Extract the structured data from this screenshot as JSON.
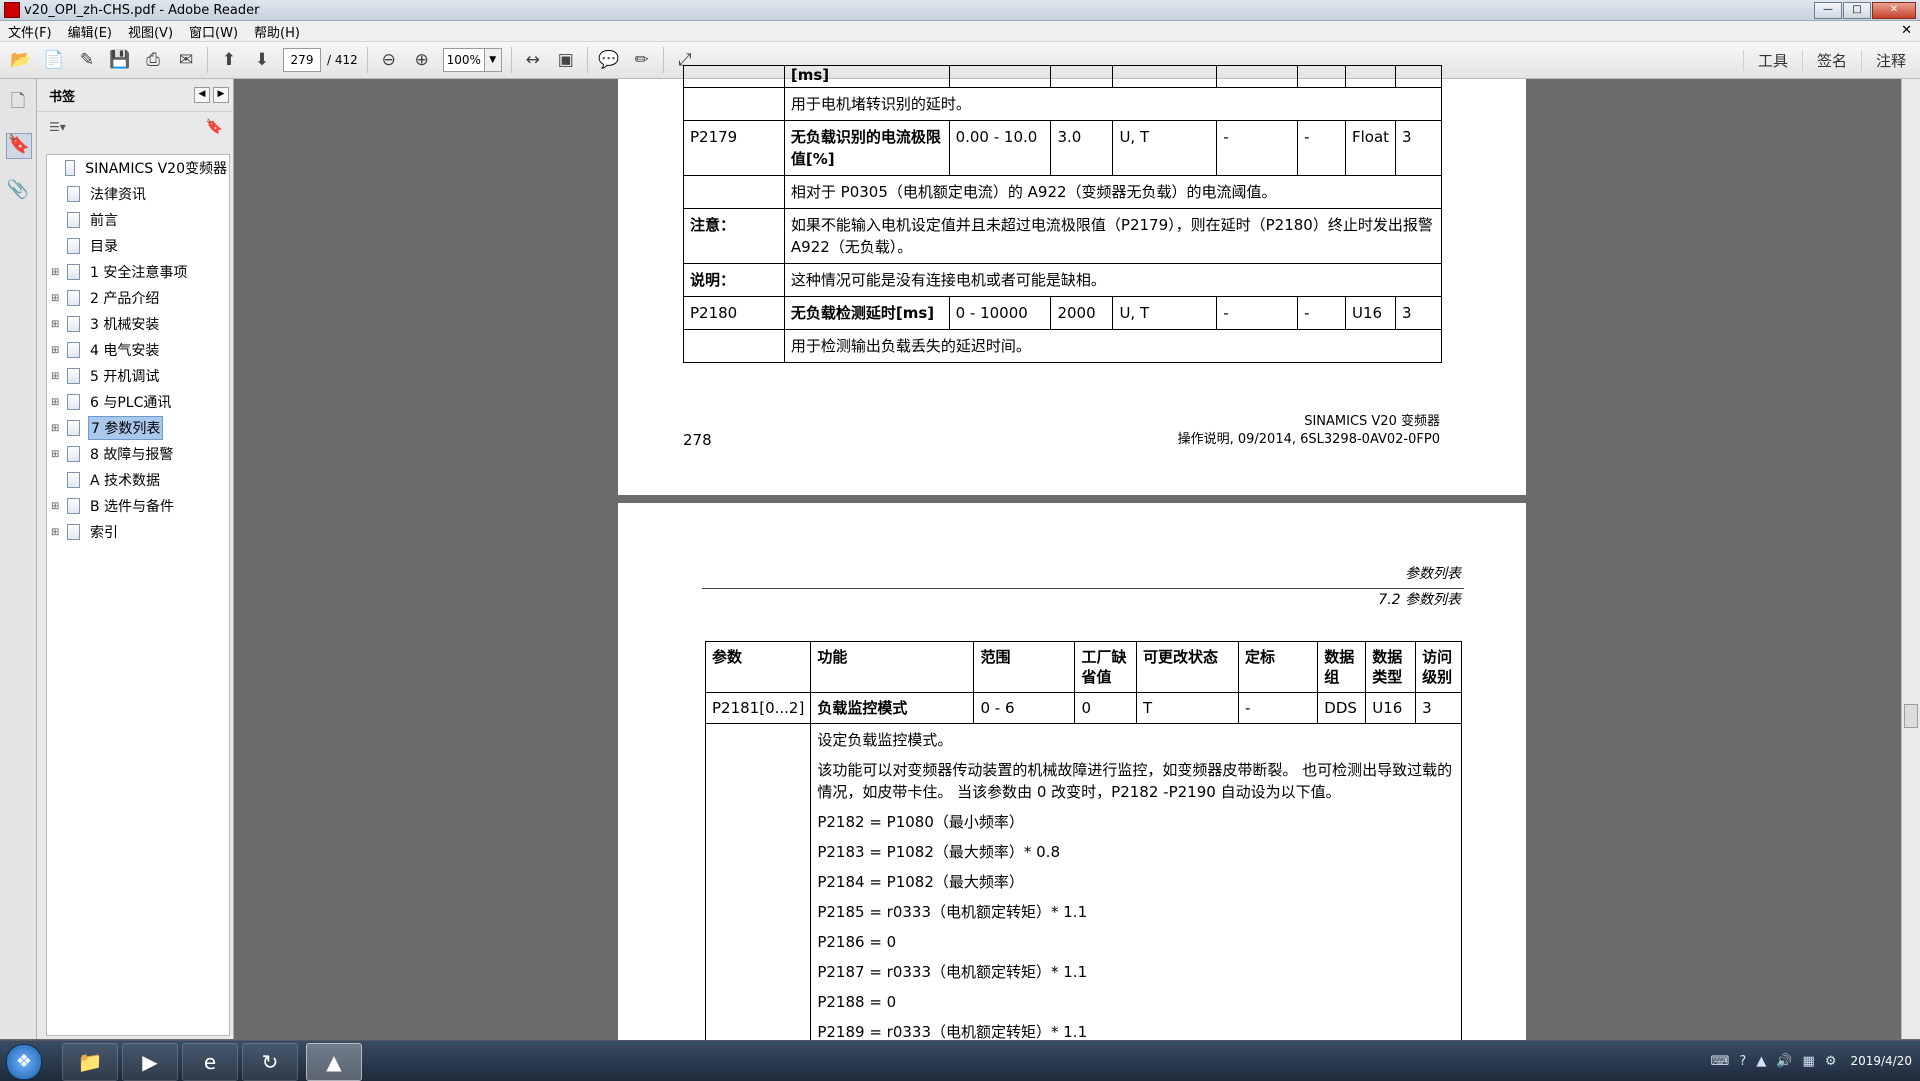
{
  "window": {
    "title": "v20_OPI_zh-CHS.pdf - Adobe Reader"
  },
  "menu": [
    "文件(F)",
    "编辑(E)",
    "视图(V)",
    "窗口(W)",
    "帮助(H)"
  ],
  "toolbar": {
    "page_current": "279",
    "page_total": "/ 412",
    "zoom": "100%",
    "right_links": [
      "工具",
      "签名",
      "注释"
    ]
  },
  "bookmarks": {
    "header": "书签",
    "items": [
      {
        "label": "SINAMICS V20变频器",
        "expandable": false,
        "selected": false
      },
      {
        "label": "法律资讯",
        "expandable": false,
        "selected": false
      },
      {
        "label": "前言",
        "expandable": false,
        "selected": false
      },
      {
        "label": "目录",
        "expandable": false,
        "selected": false
      },
      {
        "label": "1 安全注意事项",
        "expandable": true,
        "selected": false
      },
      {
        "label": "2 产品介绍",
        "expandable": true,
        "selected": false
      },
      {
        "label": "3 机械安装",
        "expandable": true,
        "selected": false
      },
      {
        "label": "4 电气安装",
        "expandable": true,
        "selected": false
      },
      {
        "label": "5 开机调试",
        "expandable": true,
        "selected": false
      },
      {
        "label": "6 与PLC通讯",
        "expandable": true,
        "selected": false
      },
      {
        "label": "7 参数列表",
        "expandable": true,
        "selected": true
      },
      {
        "label": "8 故障与报警",
        "expandable": true,
        "selected": false
      },
      {
        "label": "A 技术数据",
        "expandable": false,
        "selected": false
      },
      {
        "label": "B 选件与备件",
        "expandable": true,
        "selected": false
      },
      {
        "label": "索引",
        "expandable": true,
        "selected": false
      }
    ]
  },
  "page1": {
    "top_fragment": "[ms]",
    "row0_desc": "用于电机堵转识别的延时。",
    "p2179": {
      "param": "P2179",
      "func": "无负载识别的电流极限值[%]",
      "range": "0.00 - 10.0",
      "default": "3.0",
      "change": "U, T",
      "scale": "-",
      "group": "-",
      "type": "Float",
      "access": "3",
      "desc": "相对于 P0305（电机额定电流）的 A922（变频器无负载）的电流阈值。",
      "note_label": "注意：",
      "note": "如果不能输入电机设定值并且未超过电流极限值（P2179），则在延时（P2180）终止时发出报警 A922（无负载）。",
      "explain_label": "说明：",
      "explain": "这种情况可能是没有连接电机或者可能是缺相。"
    },
    "p2180": {
      "param": "P2180",
      "func": "无负载检测延时[ms]",
      "range": "0 - 10000",
      "default": "2000",
      "change": "U, T",
      "scale": "-",
      "group": "-",
      "type": "U16",
      "access": "3",
      "desc": "用于检测输出负载丢失的延迟时间。"
    },
    "page_number": "278",
    "footer_line1": "SINAMICS V20 变频器",
    "footer_line2": "操作说明, 09/2014, 6SL3298-0AV02-0FP0"
  },
  "page2": {
    "running_head1": "参数列表",
    "running_head2": "7.2 参数列表",
    "headers": [
      "参数",
      "功能",
      "范围",
      "工厂缺省值",
      "可更改状态",
      "定标",
      "数据组",
      "数据类型",
      "访问级别"
    ],
    "row": [
      "P2181[0...2]",
      "负载监控模式",
      "0 - 6",
      "0",
      "T",
      "-",
      "DDS",
      "U16",
      "3"
    ],
    "desc_lines": [
      "设定负载监控模式。",
      "该功能可以对变频器传动装置的机械故障进行监控，如变频器皮带断裂。 也可检测出导致过载的情况，如皮带卡住。 当该参数由 0 改变时，P2182 -P2190 自动设为以下值。",
      "P2182 = P1080（最小频率）",
      "P2183 = P1082（最大频率）* 0.8",
      "P2184 = P1082（最大频率）",
      "P2185 = r0333（电机额定转矩）* 1.1",
      "P2186 = 0",
      "P2187 = r0333（电机额定转矩）* 1.1",
      "P2188 = 0",
      "P2189 = r0333（电机额定转矩）* 1.1"
    ]
  },
  "taskbar": {
    "date": "2019/4/20"
  }
}
